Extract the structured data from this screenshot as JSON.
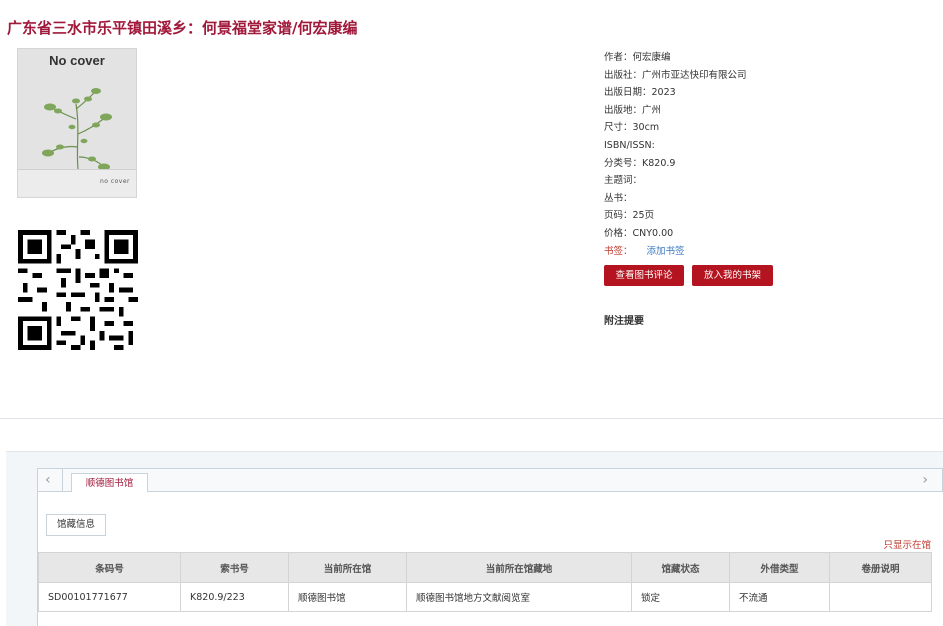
{
  "title": "广东省三水市乐平镇田溪乡：何景福堂家谱/何宏康编",
  "cover": {
    "text": "No cover",
    "footer": "no cover"
  },
  "meta": [
    {
      "label": "作者：",
      "value": "何宏康编"
    },
    {
      "label": "出版社：",
      "value": "广州市亚达快印有限公司"
    },
    {
      "label": "出版日期：",
      "value": "2023"
    },
    {
      "label": "出版地：",
      "value": "广州"
    },
    {
      "label": "尺寸：",
      "value": "30cm"
    },
    {
      "label": "ISBN/ISSN:",
      "value": ""
    },
    {
      "label": "分类号：",
      "value": "K820.9"
    },
    {
      "label": "主题词：",
      "value": ""
    },
    {
      "label": "丛书：",
      "value": ""
    },
    {
      "label": "页码：",
      "value": "25页"
    },
    {
      "label": "价格：",
      "value": "CNY0.00"
    }
  ],
  "bookmark": {
    "label": "书签：",
    "link": "添加书签"
  },
  "buttons": {
    "review": "查看图书评论",
    "shelf": "放入我的书架"
  },
  "notes_label": "附注提要",
  "tabs": {
    "library": "顺德图书馆",
    "holdings": "馆藏信息",
    "left_arrow": "‹",
    "right_arrow": "›"
  },
  "only_show": "只显示在馆",
  "table": {
    "headers": [
      "条码号",
      "索书号",
      "当前所在馆",
      "当前所在馆藏地",
      "馆藏状态",
      "外借类型",
      "卷册说明"
    ],
    "rows": [
      [
        "SD00101771677",
        "K820.9/223",
        "顺德图书馆",
        "顺德图书馆地方文献阅览室",
        "锁定",
        "不流通",
        ""
      ]
    ]
  },
  "colors": {
    "brand": "#a0183a",
    "button": "#b3141f",
    "link": "#3a78c2"
  }
}
